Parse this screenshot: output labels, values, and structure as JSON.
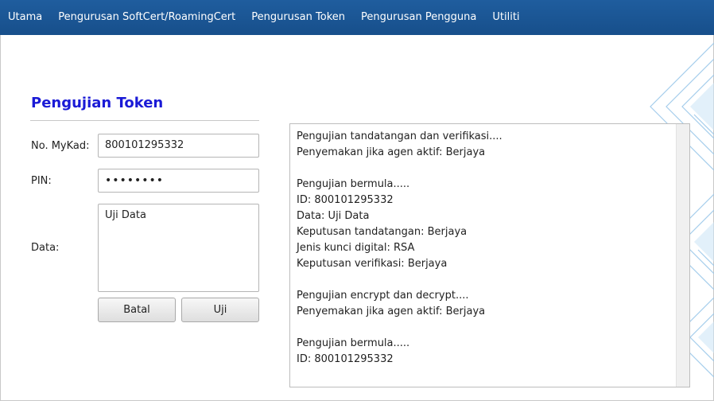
{
  "menu": {
    "items": [
      "Utama",
      "Pengurusan SoftCert/RoamingCert",
      "Pengurusan Token",
      "Pengurusan Pengguna",
      "Utiliti"
    ]
  },
  "form": {
    "title": "Pengujian Token",
    "mykad_label": "No. MyKad:",
    "mykad_value": "800101295332",
    "pin_label": "PIN:",
    "pin_value": "••••••••",
    "data_label": "Data:",
    "data_value": "Uji Data",
    "cancel_label": "Batal",
    "test_label": "Uji"
  },
  "output": {
    "lines": [
      "Pengujian tandatangan dan verifikasi....",
      "Penyemakan jika agen aktif: Berjaya",
      "",
      "Pengujian bermula.....",
      "ID: 800101295332",
      "Data: Uji Data",
      "Keputusan tandatangan: Berjaya",
      "Jenis kunci digital: RSA",
      "Keputusan verifikasi: Berjaya",
      "",
      "Pengujian encrypt dan decrypt....",
      "Penyemakan jika agen aktif: Berjaya",
      "",
      "Pengujian bermula.....",
      "ID: 800101295332"
    ]
  },
  "colors": {
    "menubar": "#1a5695",
    "title": "#1a1ad6",
    "deco": "#8fbfe3"
  }
}
